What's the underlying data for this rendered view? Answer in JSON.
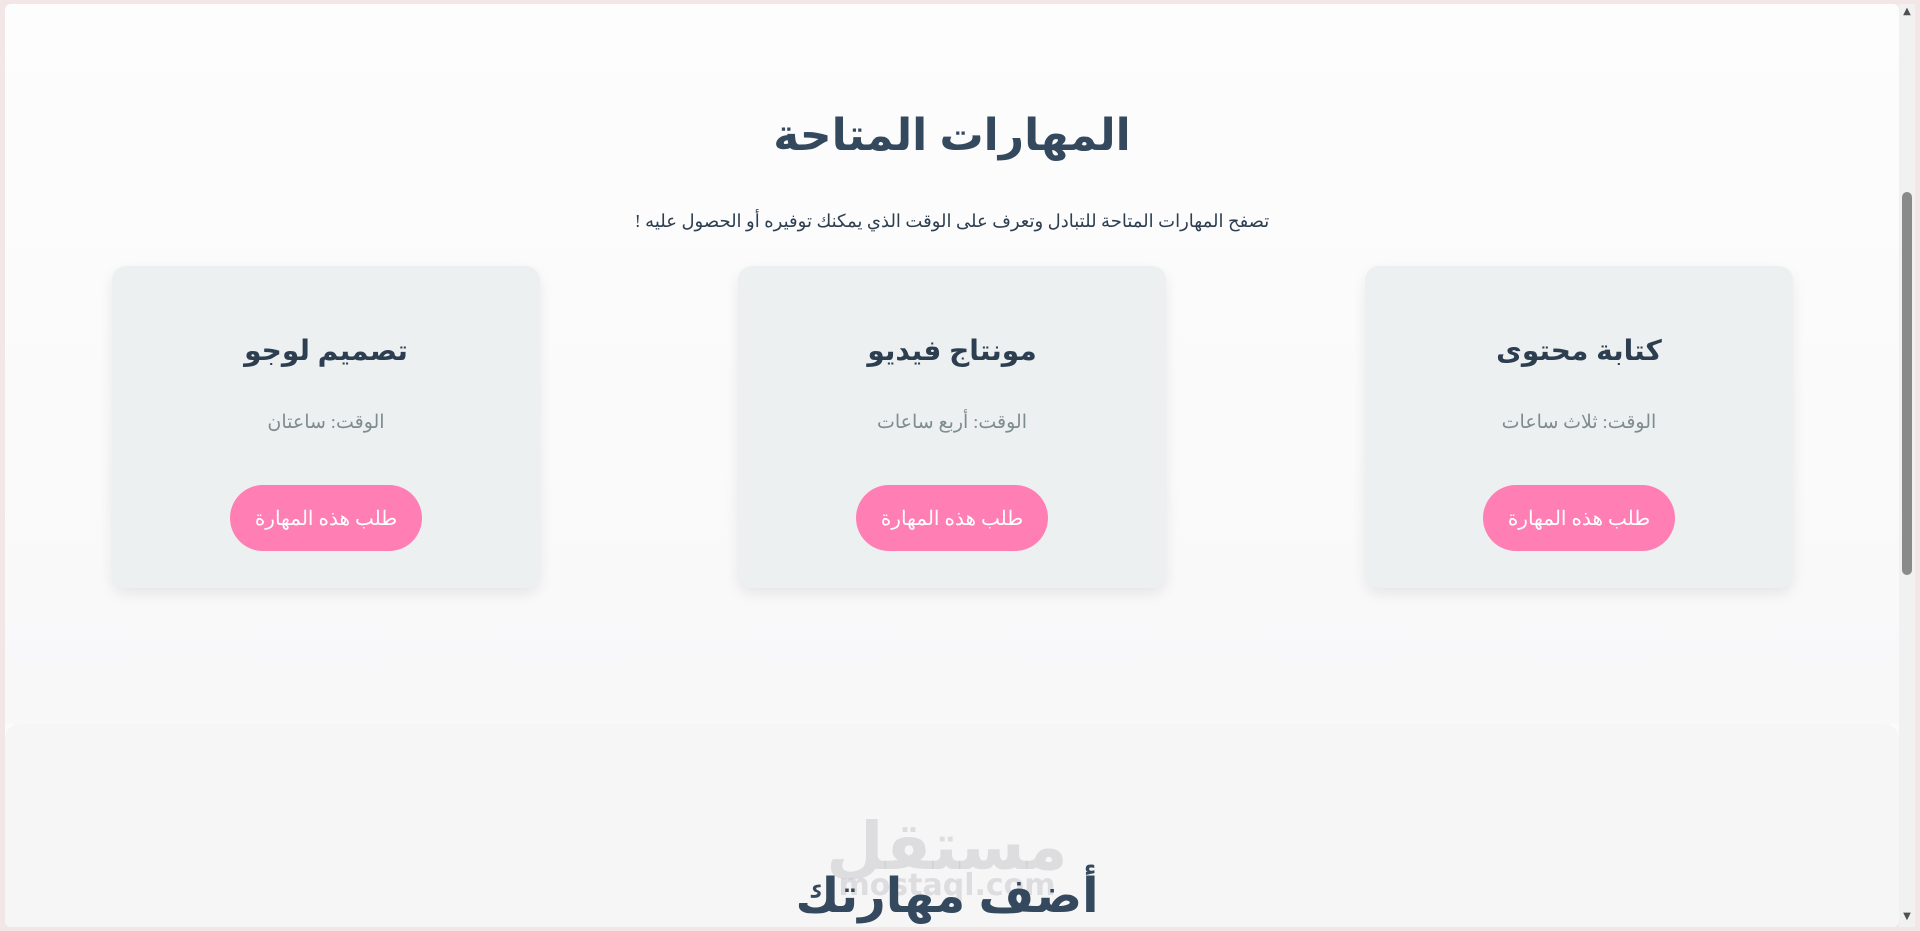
{
  "skills": {
    "title": "المهارات المتاحة",
    "subtitle": "تصفح المهارات المتاحة للتبادل وتعرف على الوقت الذي يمكنك توفيره أو الحصول عليه !",
    "cards": [
      {
        "title": "كتابة محتوى",
        "time": "الوقت: ثلاث ساعات",
        "button": "طلب هذه المهارة"
      },
      {
        "title": "مونتاج فيديو",
        "time": "الوقت: أربع ساعات",
        "button": "طلب هذه المهارة"
      },
      {
        "title": "تصميم لوجو",
        "time": "الوقت: ساعتان",
        "button": "طلب هذه المهارة"
      }
    ]
  },
  "add_skill": {
    "title": "أضف مهارتك"
  },
  "watermark": {
    "arabic": "مستقل",
    "latin": "mostaql.com"
  },
  "scrollbar": {
    "up_icon": "triangle-up",
    "down_icon": "triangle-down"
  },
  "colors": {
    "accent": "#ff7eb3",
    "heading": "#34495e",
    "card_bg": "#ecf0f1",
    "muted_text": "#7f8c8d"
  }
}
